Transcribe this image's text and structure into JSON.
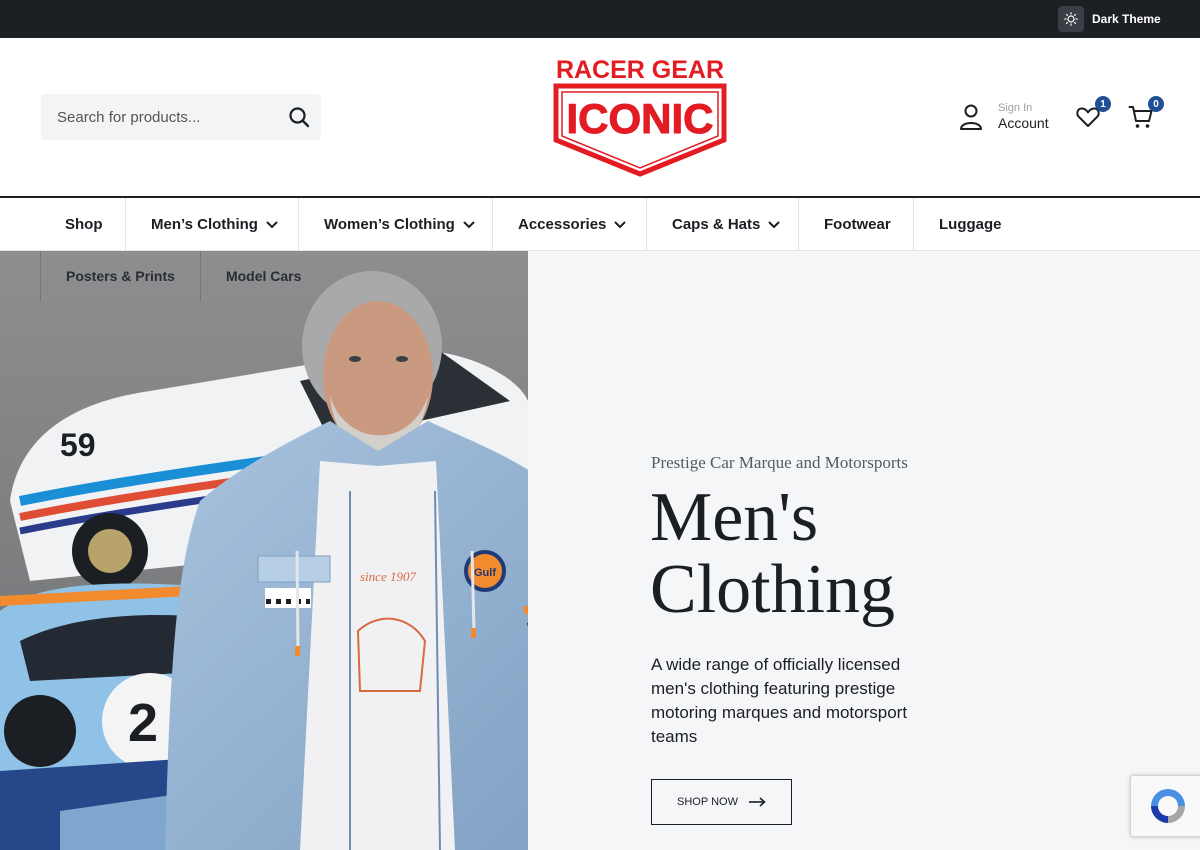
{
  "topbar": {
    "theme_label": "Dark Theme"
  },
  "header": {
    "search": {
      "placeholder": "Search for products..."
    },
    "logo": {
      "line1": "RACER GEAR",
      "line2": "ICONIC"
    },
    "account": {
      "sign_in": "Sign In",
      "label": "Account"
    },
    "wishlist": {
      "count": "1"
    },
    "cart": {
      "count": "0"
    }
  },
  "nav": {
    "items": [
      {
        "label": "Shop"
      },
      {
        "label": "Men’s Clothing"
      },
      {
        "label": "Women’s Clothing"
      },
      {
        "label": "Accessories"
      },
      {
        "label": "Caps & Hats"
      },
      {
        "label": "Footwear"
      },
      {
        "label": "Luggage"
      },
      {
        "label": "Posters & Prints"
      },
      {
        "label": "Model Cars"
      }
    ]
  },
  "hero": {
    "kicker": "Prestige Car Marque and Motorsports",
    "title": "Men's Clothing",
    "description": "A wide range of officially licensed men's clothing featuring prestige motoring marques and motorsport teams",
    "button": "SHOP NOW",
    "image_text": {
      "car_number_1": "59",
      "car_number_2": "2",
      "badge": "Gulf",
      "shirt_text": "since 1907"
    }
  },
  "colors": {
    "accent": "#e31b23",
    "badge": "#1f4f94",
    "topbar": "#1c1f24",
    "hero_bg": "#f5f6f8"
  }
}
